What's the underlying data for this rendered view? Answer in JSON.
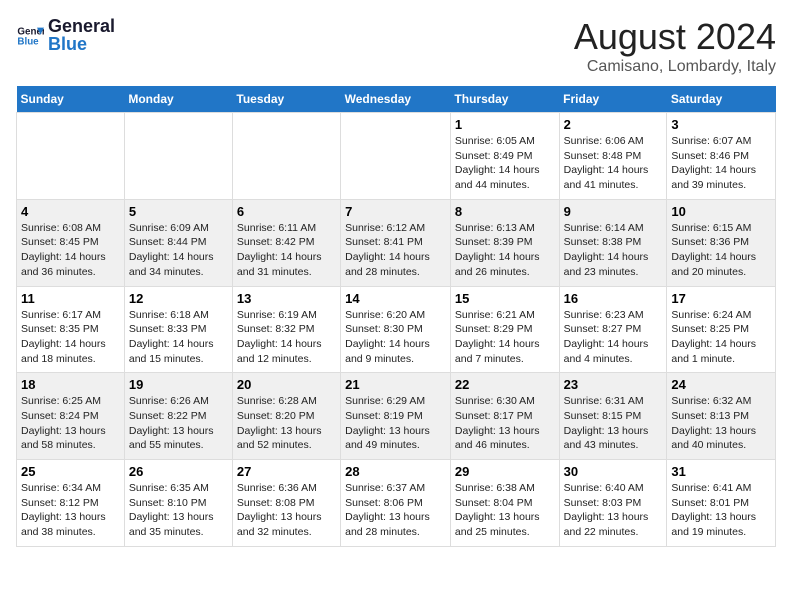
{
  "logo": {
    "line1": "General",
    "line2": "Blue"
  },
  "title": "August 2024",
  "location": "Camisano, Lombardy, Italy",
  "weekdays": [
    "Sunday",
    "Monday",
    "Tuesday",
    "Wednesday",
    "Thursday",
    "Friday",
    "Saturday"
  ],
  "weeks": [
    [
      {
        "day": "",
        "info": ""
      },
      {
        "day": "",
        "info": ""
      },
      {
        "day": "",
        "info": ""
      },
      {
        "day": "",
        "info": ""
      },
      {
        "day": "1",
        "info": "Sunrise: 6:05 AM\nSunset: 8:49 PM\nDaylight: 14 hours and 44 minutes."
      },
      {
        "day": "2",
        "info": "Sunrise: 6:06 AM\nSunset: 8:48 PM\nDaylight: 14 hours and 41 minutes."
      },
      {
        "day": "3",
        "info": "Sunrise: 6:07 AM\nSunset: 8:46 PM\nDaylight: 14 hours and 39 minutes."
      }
    ],
    [
      {
        "day": "4",
        "info": "Sunrise: 6:08 AM\nSunset: 8:45 PM\nDaylight: 14 hours and 36 minutes."
      },
      {
        "day": "5",
        "info": "Sunrise: 6:09 AM\nSunset: 8:44 PM\nDaylight: 14 hours and 34 minutes."
      },
      {
        "day": "6",
        "info": "Sunrise: 6:11 AM\nSunset: 8:42 PM\nDaylight: 14 hours and 31 minutes."
      },
      {
        "day": "7",
        "info": "Sunrise: 6:12 AM\nSunset: 8:41 PM\nDaylight: 14 hours and 28 minutes."
      },
      {
        "day": "8",
        "info": "Sunrise: 6:13 AM\nSunset: 8:39 PM\nDaylight: 14 hours and 26 minutes."
      },
      {
        "day": "9",
        "info": "Sunrise: 6:14 AM\nSunset: 8:38 PM\nDaylight: 14 hours and 23 minutes."
      },
      {
        "day": "10",
        "info": "Sunrise: 6:15 AM\nSunset: 8:36 PM\nDaylight: 14 hours and 20 minutes."
      }
    ],
    [
      {
        "day": "11",
        "info": "Sunrise: 6:17 AM\nSunset: 8:35 PM\nDaylight: 14 hours and 18 minutes."
      },
      {
        "day": "12",
        "info": "Sunrise: 6:18 AM\nSunset: 8:33 PM\nDaylight: 14 hours and 15 minutes."
      },
      {
        "day": "13",
        "info": "Sunrise: 6:19 AM\nSunset: 8:32 PM\nDaylight: 14 hours and 12 minutes."
      },
      {
        "day": "14",
        "info": "Sunrise: 6:20 AM\nSunset: 8:30 PM\nDaylight: 14 hours and 9 minutes."
      },
      {
        "day": "15",
        "info": "Sunrise: 6:21 AM\nSunset: 8:29 PM\nDaylight: 14 hours and 7 minutes."
      },
      {
        "day": "16",
        "info": "Sunrise: 6:23 AM\nSunset: 8:27 PM\nDaylight: 14 hours and 4 minutes."
      },
      {
        "day": "17",
        "info": "Sunrise: 6:24 AM\nSunset: 8:25 PM\nDaylight: 14 hours and 1 minute."
      }
    ],
    [
      {
        "day": "18",
        "info": "Sunrise: 6:25 AM\nSunset: 8:24 PM\nDaylight: 13 hours and 58 minutes."
      },
      {
        "day": "19",
        "info": "Sunrise: 6:26 AM\nSunset: 8:22 PM\nDaylight: 13 hours and 55 minutes."
      },
      {
        "day": "20",
        "info": "Sunrise: 6:28 AM\nSunset: 8:20 PM\nDaylight: 13 hours and 52 minutes."
      },
      {
        "day": "21",
        "info": "Sunrise: 6:29 AM\nSunset: 8:19 PM\nDaylight: 13 hours and 49 minutes."
      },
      {
        "day": "22",
        "info": "Sunrise: 6:30 AM\nSunset: 8:17 PM\nDaylight: 13 hours and 46 minutes."
      },
      {
        "day": "23",
        "info": "Sunrise: 6:31 AM\nSunset: 8:15 PM\nDaylight: 13 hours and 43 minutes."
      },
      {
        "day": "24",
        "info": "Sunrise: 6:32 AM\nSunset: 8:13 PM\nDaylight: 13 hours and 40 minutes."
      }
    ],
    [
      {
        "day": "25",
        "info": "Sunrise: 6:34 AM\nSunset: 8:12 PM\nDaylight: 13 hours and 38 minutes."
      },
      {
        "day": "26",
        "info": "Sunrise: 6:35 AM\nSunset: 8:10 PM\nDaylight: 13 hours and 35 minutes."
      },
      {
        "day": "27",
        "info": "Sunrise: 6:36 AM\nSunset: 8:08 PM\nDaylight: 13 hours and 32 minutes."
      },
      {
        "day": "28",
        "info": "Sunrise: 6:37 AM\nSunset: 8:06 PM\nDaylight: 13 hours and 28 minutes."
      },
      {
        "day": "29",
        "info": "Sunrise: 6:38 AM\nSunset: 8:04 PM\nDaylight: 13 hours and 25 minutes."
      },
      {
        "day": "30",
        "info": "Sunrise: 6:40 AM\nSunset: 8:03 PM\nDaylight: 13 hours and 22 minutes."
      },
      {
        "day": "31",
        "info": "Sunrise: 6:41 AM\nSunset: 8:01 PM\nDaylight: 13 hours and 19 minutes."
      }
    ]
  ]
}
